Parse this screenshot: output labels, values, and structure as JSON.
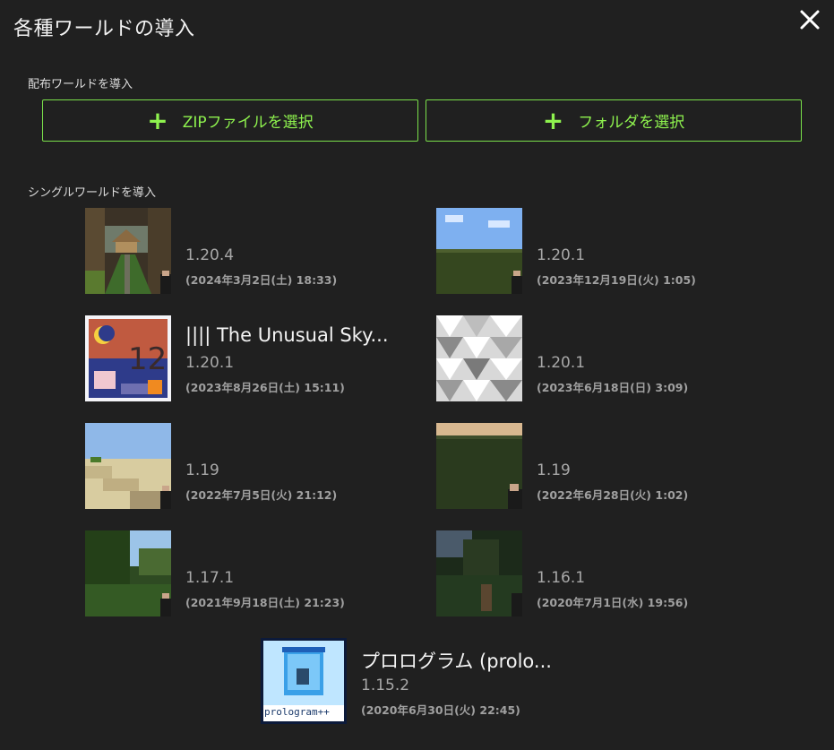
{
  "dialog": {
    "title": "各種ワールドの導入",
    "close_icon": "close-icon"
  },
  "distribution": {
    "label": "配布ワールドを導入",
    "zip_button": "ZIPファイルを選択",
    "folder_button": "フォルダを選択",
    "plus_icon": "plus-icon"
  },
  "single": {
    "label": "シングルワールドを導入",
    "worlds": [
      {
        "name": "",
        "version": "1.20.4",
        "date": "(2024年3月2日(土) 18:33)"
      },
      {
        "name": "",
        "version": "1.20.1",
        "date": "(2023年12月19日(火) 1:05)"
      },
      {
        "name": "|||| The Unusual Sky...",
        "version": "1.20.1",
        "date": "(2023年8月26日(土) 15:11)"
      },
      {
        "name": "",
        "version": "1.20.1",
        "date": "(2023年6月18日(日) 3:09)"
      },
      {
        "name": "",
        "version": "1.19",
        "date": "(2022年7月5日(火) 21:12)"
      },
      {
        "name": "",
        "version": "1.19",
        "date": "(2022年6月28日(火) 1:02)"
      },
      {
        "name": "",
        "version": "1.17.1",
        "date": "(2021年9月18日(土) 21:23)"
      },
      {
        "name": "",
        "version": "1.16.1",
        "date": "(2020年7月1日(水) 19:56)"
      },
      {
        "name": "プロログラム (prolo...",
        "version": "1.15.2",
        "date": "(2020年6月30日(火) 22:45)",
        "thumb_caption": "prologram++"
      }
    ]
  },
  "colors": {
    "accent": "#8ef24e",
    "background": "#202020"
  }
}
